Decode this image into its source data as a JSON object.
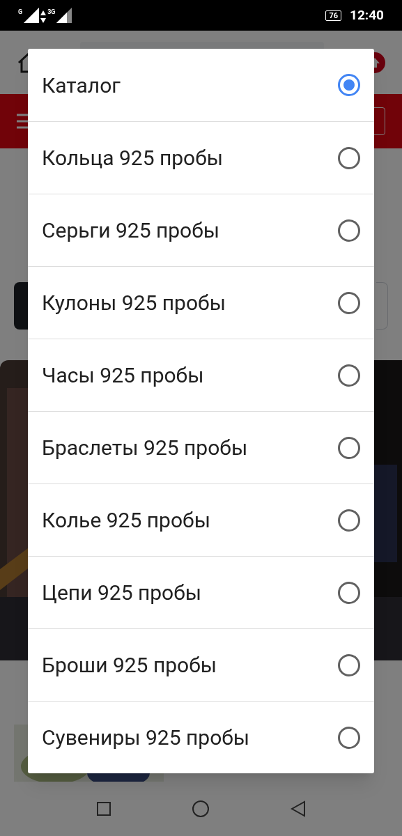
{
  "status_bar": {
    "network_1": "G",
    "network_2": "3G",
    "battery": "76",
    "time": "12:40"
  },
  "dialog": {
    "options": [
      {
        "label": "Каталог",
        "selected": true
      },
      {
        "label": "Кольца 925 пробы",
        "selected": false
      },
      {
        "label": "Серьги 925 пробы",
        "selected": false
      },
      {
        "label": "Кулоны 925 пробы",
        "selected": false
      },
      {
        "label": "Часы 925 пробы",
        "selected": false
      },
      {
        "label": "Браслеты 925 пробы",
        "selected": false
      },
      {
        "label": "Колье 925 пробы",
        "selected": false
      },
      {
        "label": "Цепи 925 пробы",
        "selected": false
      },
      {
        "label": "Броши 925 пробы",
        "selected": false
      },
      {
        "label": "Сувениры 925 пробы",
        "selected": false
      }
    ]
  }
}
